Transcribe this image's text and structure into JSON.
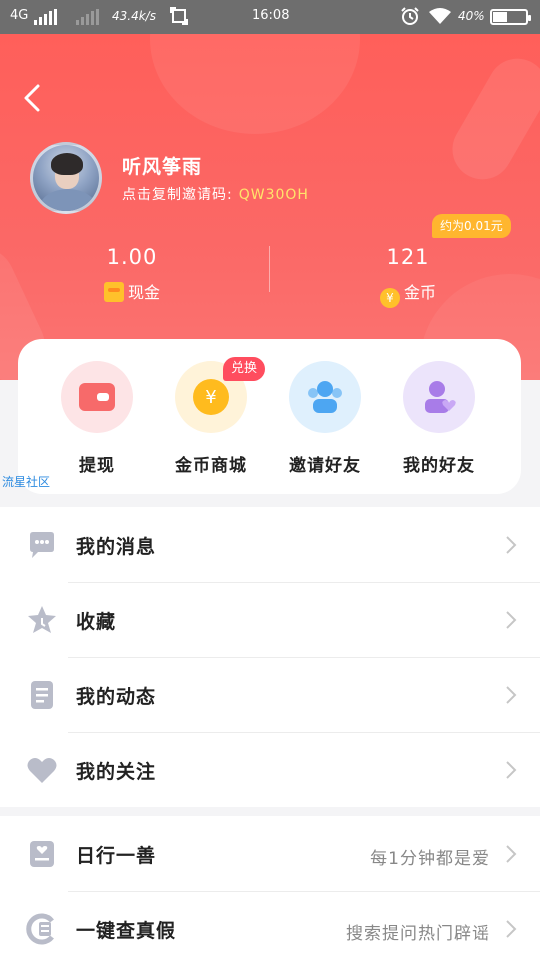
{
  "status_bar": {
    "network": "4G",
    "speed": "43.4k/s",
    "time": "16:08",
    "battery_percent": "40",
    "battery_level": 0.4
  },
  "profile": {
    "username": "听风筝雨",
    "invite_label": "点击复制邀请码:",
    "invite_code": "QW30OH"
  },
  "approx_badge": "约为0.01元",
  "stats": {
    "cash": {
      "value": "1.00",
      "label": "现金"
    },
    "coins": {
      "value": "121",
      "label": "金币",
      "icon_glyph": "¥"
    }
  },
  "quick_actions": {
    "exchange_badge": "兑换",
    "items": [
      {
        "label": "提现",
        "icon": "wallet-icon",
        "bg": "#fde4e6",
        "fg": "#f76a6a"
      },
      {
        "label": "金币商城",
        "icon": "coin-icon",
        "bg": "#fff3d9",
        "fg": "#ffbb1e",
        "glyph": "¥"
      },
      {
        "label": "邀请好友",
        "icon": "invite-friends-icon",
        "bg": "#dff0fd",
        "fg": "#4da6f2"
      },
      {
        "label": "我的好友",
        "icon": "my-friends-icon",
        "bg": "#ece4fb",
        "fg": "#a87ce8"
      }
    ]
  },
  "watermark": "流星社区",
  "menu_group_1": [
    {
      "label": "我的消息",
      "icon": "message-icon"
    },
    {
      "label": "收藏",
      "icon": "star-icon"
    },
    {
      "label": "我的动态",
      "icon": "document-icon"
    },
    {
      "label": "我的关注",
      "icon": "heart-icon"
    }
  ],
  "menu_group_2": [
    {
      "label": "日行一善",
      "icon": "charity-icon",
      "sub": "每1分钟都是爱"
    },
    {
      "label": "一键查真假",
      "icon": "rumor-check-icon",
      "sub": "搜索提问热门辟谣"
    }
  ],
  "colors": {
    "header_red": "#ff5f5a",
    "accent_yellow": "#ffe46b",
    "badge_orange": "#ffb62e",
    "badge_red": "#ff4d5e",
    "menu_icon_grey": "#b9bcc9"
  }
}
